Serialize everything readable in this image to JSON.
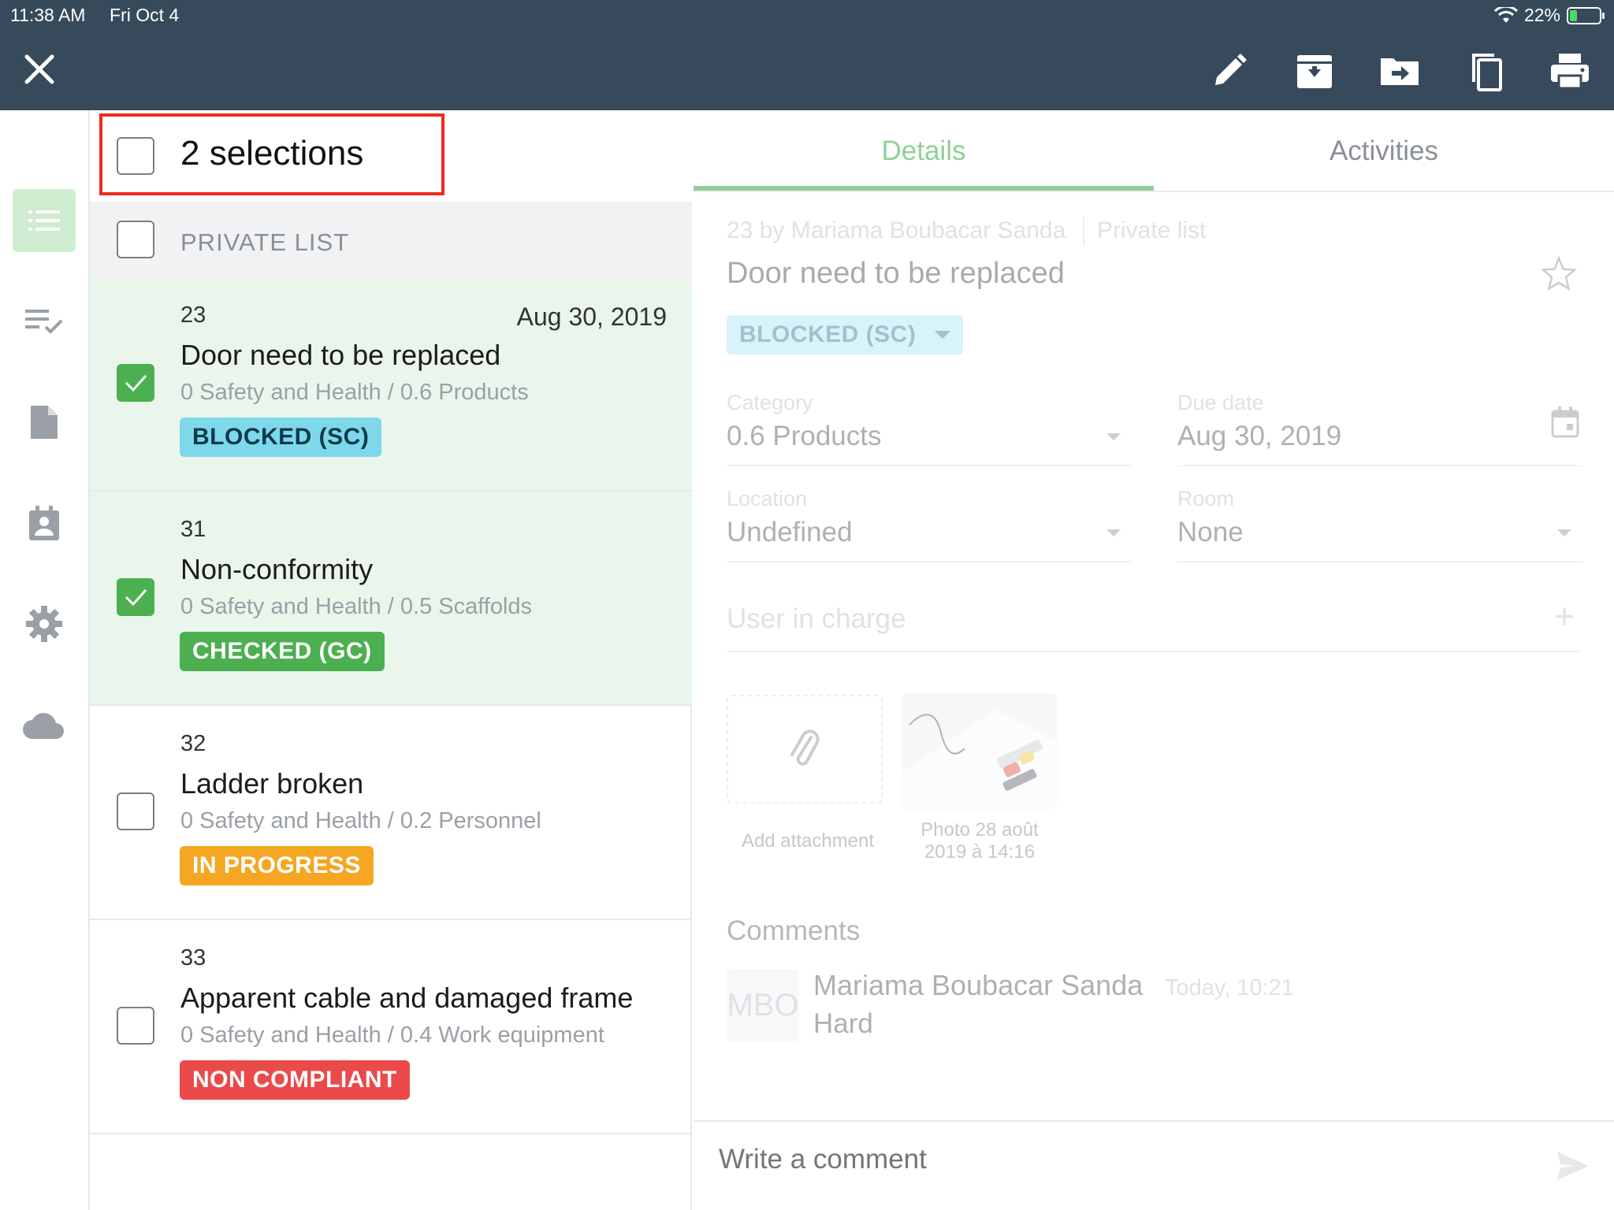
{
  "status_bar": {
    "time": "11:38 AM",
    "date": "Fri Oct 4",
    "battery": "22%"
  },
  "toolbar": {
    "icons": [
      "close-icon",
      "edit-icon",
      "archive-icon",
      "move-icon",
      "copy-icon",
      "print-icon"
    ]
  },
  "rail": {
    "items": [
      "list-icon",
      "checklist-icon",
      "document-icon",
      "contacts-icon",
      "gear-icon",
      "cloud-icon"
    ]
  },
  "selection": {
    "title": "2 selections"
  },
  "group": {
    "title": "PRIVATE LIST"
  },
  "items": [
    {
      "num": "23",
      "date": "Aug 30, 2019",
      "title": "Door need to be replaced",
      "path": "0 Safety and Health / 0.6 Products",
      "badge": "BLOCKED (SC)",
      "checked": true
    },
    {
      "num": "31",
      "date": "",
      "title": "Non-conformity",
      "path": "0 Safety and Health / 0.5 Scaffolds",
      "badge": "CHECKED (GC)",
      "checked": true
    },
    {
      "num": "32",
      "date": "",
      "title": "Ladder broken",
      "path": "0 Safety and Health / 0.2 Personnel",
      "badge": "IN PROGRESS",
      "checked": false
    },
    {
      "num": "33",
      "date": "",
      "title": "Apparent cable and damaged frame",
      "path": "0 Safety and Health / 0.4 Work equipment",
      "badge": "NON COMPLIANT",
      "checked": false
    }
  ],
  "badge_colors": {
    "blocked": {
      "bg": "#7dd8ec",
      "fg": "#0e3a47"
    },
    "checked": {
      "bg": "#4caf50",
      "fg": "#ffffff"
    },
    "progress": {
      "bg": "#f5a623",
      "fg": "#ffffff"
    },
    "noncompliant": {
      "bg": "#ea4a4a",
      "fg": "#ffffff"
    }
  },
  "detail": {
    "tabs": {
      "details": "Details",
      "activities": "Activities"
    },
    "meta": "23 by Mariama Boubacar Sanda",
    "list": "Private list",
    "title": "Door need to be replaced",
    "status": "BLOCKED (SC)",
    "category": {
      "label": "Category",
      "value": "0.6 Products"
    },
    "due_date": {
      "label": "Due date",
      "value": "Aug 30, 2019"
    },
    "location": {
      "label": "Location",
      "value": "Undefined"
    },
    "room": {
      "label": "Room",
      "value": "None"
    },
    "user_in_charge": "User in charge",
    "add_attachment": "Add attachment",
    "photo_label_1": "Photo 28 août",
    "photo_label_2": "2019 à 14:16",
    "comments_heading": "Comments",
    "comment": {
      "initials": "MBO",
      "author": "Mariama Boubacar Sanda",
      "time": "Today, 10:21",
      "text": "Hard"
    },
    "comment_placeholder": "Write a comment"
  }
}
